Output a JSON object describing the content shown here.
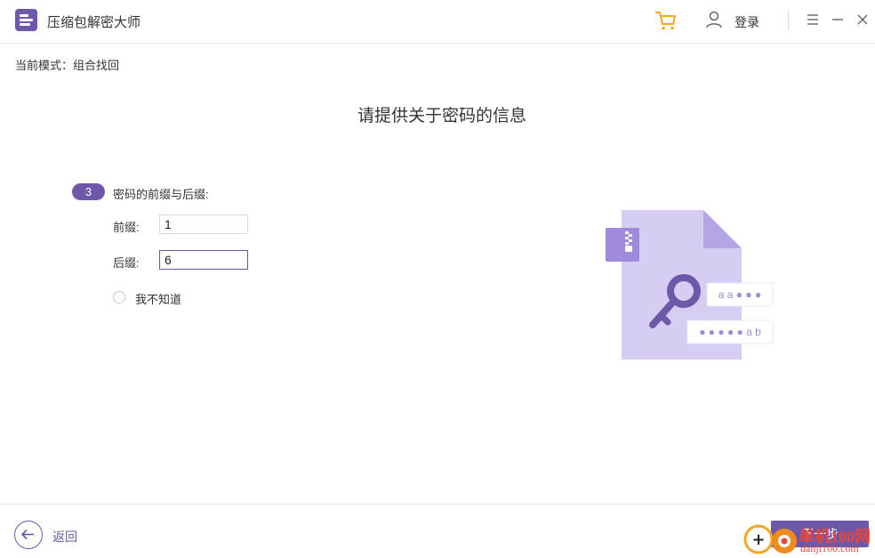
{
  "app": {
    "title": "压缩包解密大师"
  },
  "header": {
    "login_label": "登录"
  },
  "mode": {
    "label": "当前模式：组合找回"
  },
  "page": {
    "title": "请提供关于密码的信息"
  },
  "step": {
    "number": "3",
    "label": "密码的前缀与后缀:",
    "prefix_label": "前缀:",
    "prefix_value": "1",
    "suffix_label": "后缀:",
    "suffix_value": "6",
    "unknown_label": "我不知道",
    "unknown_checked": false
  },
  "illustration": {
    "tag1": "a a ● ● ●",
    "tag2": "● ● ● ● ● a b"
  },
  "footer": {
    "back_label": "返回",
    "next_label": "下一步"
  },
  "watermark": {
    "text": "单机100网",
    "url": "danji100.com"
  },
  "colors": {
    "accent": "#6e58a8",
    "cart": "#f5a623",
    "watermark": "#e8463a"
  }
}
